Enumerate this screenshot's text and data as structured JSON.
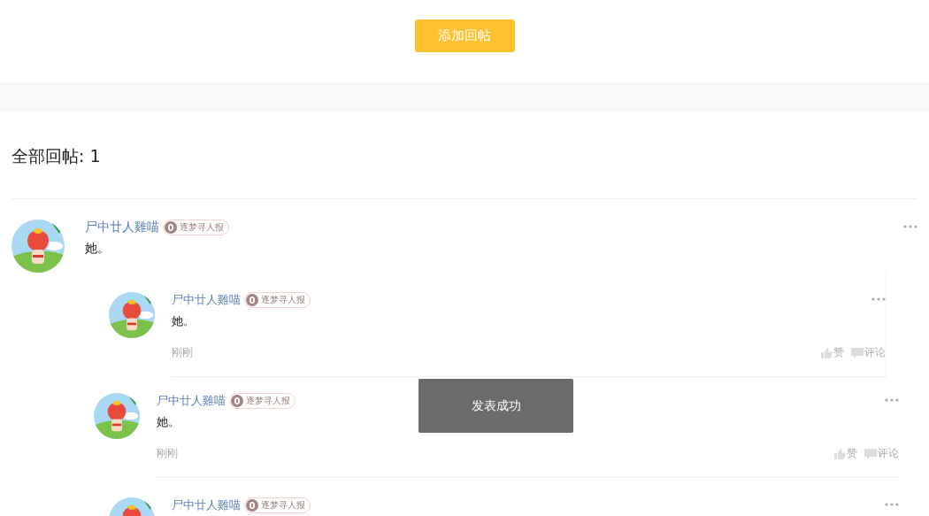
{
  "add_reply_button": "添加回帖",
  "replies_heading": "全部回帖: 1",
  "post": {
    "author": "尸中廿人雞喵",
    "badge_level": "0",
    "badge_title": "逐梦寻人报",
    "text": "她。"
  },
  "replies": [
    {
      "author": "尸中廿人雞喵",
      "badge_level": "0",
      "badge_title": "逐梦寻人报",
      "text": "她。",
      "time": "刚刚",
      "like": "赞",
      "comment": "评论"
    },
    {
      "author": "尸中廿人雞喵",
      "badge_level": "0",
      "badge_title": "逐梦寻人报",
      "text": "她。",
      "time": "刚刚",
      "like": "赞",
      "comment": "评论"
    },
    {
      "author": "尸中廿人雞喵",
      "badge_level": "0",
      "badge_title": "逐梦寻人报"
    }
  ],
  "toast": "发表成功"
}
